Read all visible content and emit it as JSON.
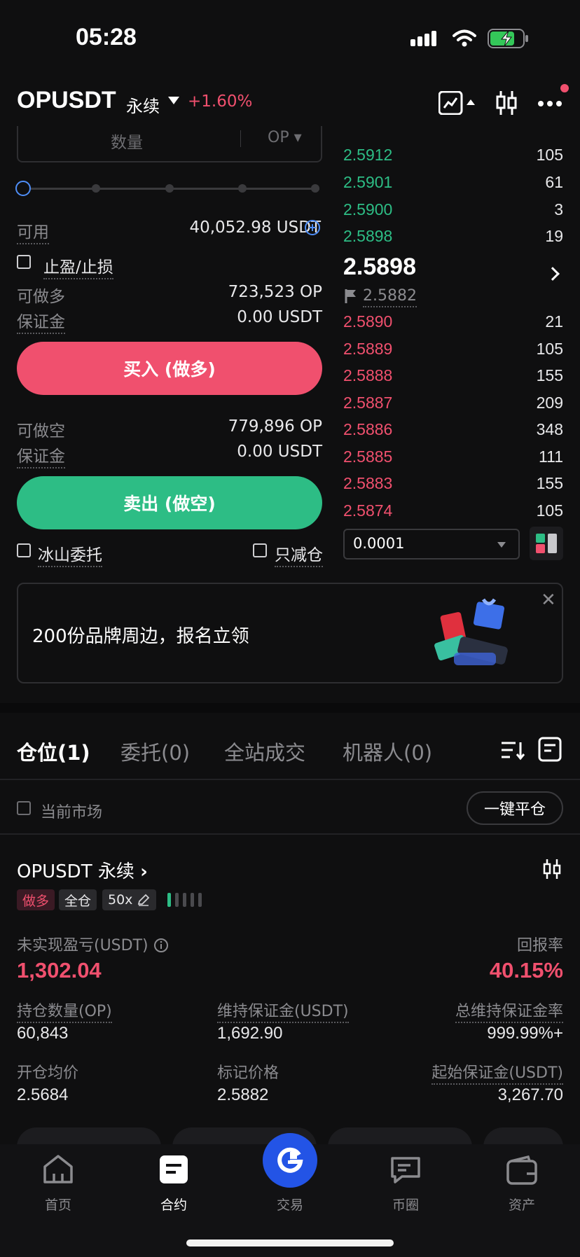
{
  "status_bar": {
    "time": "05:28"
  },
  "header": {
    "symbol": "OPUSDT",
    "contract_type": "永续",
    "change": "+1.60%"
  },
  "order_form": {
    "qty_placeholder": "数量",
    "qty_unit": "OP",
    "available_label": "可用",
    "available_value": "40,052.98 USDT",
    "tpsl_label": "止盈/止损",
    "long_max_label": "可做多",
    "long_max_value": "723,523 OP",
    "long_margin_label": "保证金",
    "long_margin_value": "0.00 USDT",
    "buy_button": "买入 (做多)",
    "short_max_label": "可做空",
    "short_max_value": "779,896 OP",
    "short_margin_label": "保证金",
    "short_margin_value": "0.00 USDT",
    "sell_button": "卖出 (做空)",
    "iceberg_label": "冰山委托",
    "reduce_only_label": "只减仓"
  },
  "order_book": {
    "asks": [
      {
        "price": "2.5912",
        "qty": "105"
      },
      {
        "price": "2.5901",
        "qty": "61"
      },
      {
        "price": "2.5900",
        "qty": "3"
      },
      {
        "price": "2.5898",
        "qty": "19"
      }
    ],
    "last_price": "2.5898",
    "mark_price": "2.5882",
    "bids": [
      {
        "price": "2.5890",
        "qty": "21"
      },
      {
        "price": "2.5889",
        "qty": "105"
      },
      {
        "price": "2.5888",
        "qty": "155"
      },
      {
        "price": "2.5887",
        "qty": "209"
      },
      {
        "price": "2.5886",
        "qty": "348"
      },
      {
        "price": "2.5885",
        "qty": "111"
      },
      {
        "price": "2.5883",
        "qty": "155"
      },
      {
        "price": "2.5874",
        "qty": "105"
      }
    ],
    "precision": "0.0001"
  },
  "banner": {
    "text": "200份品牌周边，报名立领",
    "close": "✕"
  },
  "tabs": [
    {
      "label": "仓位(1)"
    },
    {
      "label": "委托(0)"
    },
    {
      "label": "全站成交"
    },
    {
      "label": "机器人(0)"
    }
  ],
  "filter": {
    "current_market": "当前市场",
    "close_all": "一键平仓"
  },
  "position": {
    "title": "OPUSDT 永续",
    "side_tag": "做多",
    "margin_tag": "全仓",
    "leverage_tag": "50x",
    "unrealized_pnl_label": "未实现盈亏(USDT)",
    "unrealized_pnl_value": "1,302.04",
    "roe_label": "回报率",
    "roe_value": "40.15%",
    "size_label": "持仓数量(OP)",
    "size_value": "60,843",
    "maint_margin_label": "维持保证金(USDT)",
    "maint_margin_value": "1,692.90",
    "maint_rate_label": "总维持保证金率",
    "maint_rate_value": "999.99%+",
    "entry_label": "开仓均价",
    "entry_value": "2.5684",
    "mark_label": "标记价格",
    "mark_value": "2.5882",
    "init_margin_label": "起始保证金(USDT)",
    "init_margin_value": "3,267.70"
  },
  "bottom_nav": [
    {
      "label": "首页"
    },
    {
      "label": "合约"
    },
    {
      "label": "交易"
    },
    {
      "label": "币圈"
    },
    {
      "label": "资产"
    }
  ],
  "colors": {
    "buy": "#2dbd85",
    "sell": "#f0506e",
    "accent": "#2354e6"
  }
}
